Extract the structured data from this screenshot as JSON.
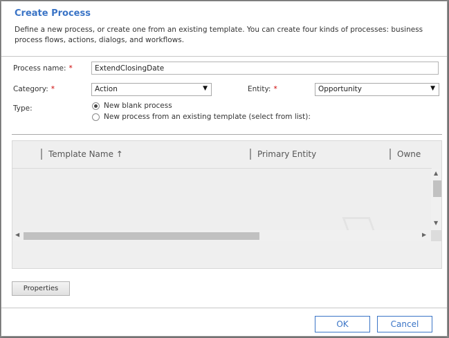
{
  "dialog": {
    "title": "Create Process",
    "description": "Define a new process, or create one from an existing template. You can create four kinds of processes: business process flows, actions, dialogs, and workflows."
  },
  "form": {
    "process_name_label": "Process name:",
    "process_name_value": "ExtendClosingDate",
    "required_mark": "*",
    "category_label": "Category:",
    "category_value": "Action",
    "entity_label": "Entity:",
    "entity_value": "Opportunity",
    "type_label": "Type:",
    "type_options": [
      {
        "label": "New blank process",
        "checked": true
      },
      {
        "label": "New process from an existing template (select from list):",
        "checked": false
      }
    ]
  },
  "grid": {
    "columns": [
      "Template Name ↑",
      "Primary Entity",
      "Owne"
    ]
  },
  "icons": {
    "dropdown": "▼",
    "scroll_up": "▲",
    "scroll_down": "▼",
    "scroll_left": "◀",
    "scroll_right": "▶"
  },
  "buttons": {
    "properties": "Properties",
    "ok": "OK",
    "cancel": "Cancel"
  },
  "colors": {
    "accent": "#3a74c6",
    "required": "#cc0000"
  }
}
